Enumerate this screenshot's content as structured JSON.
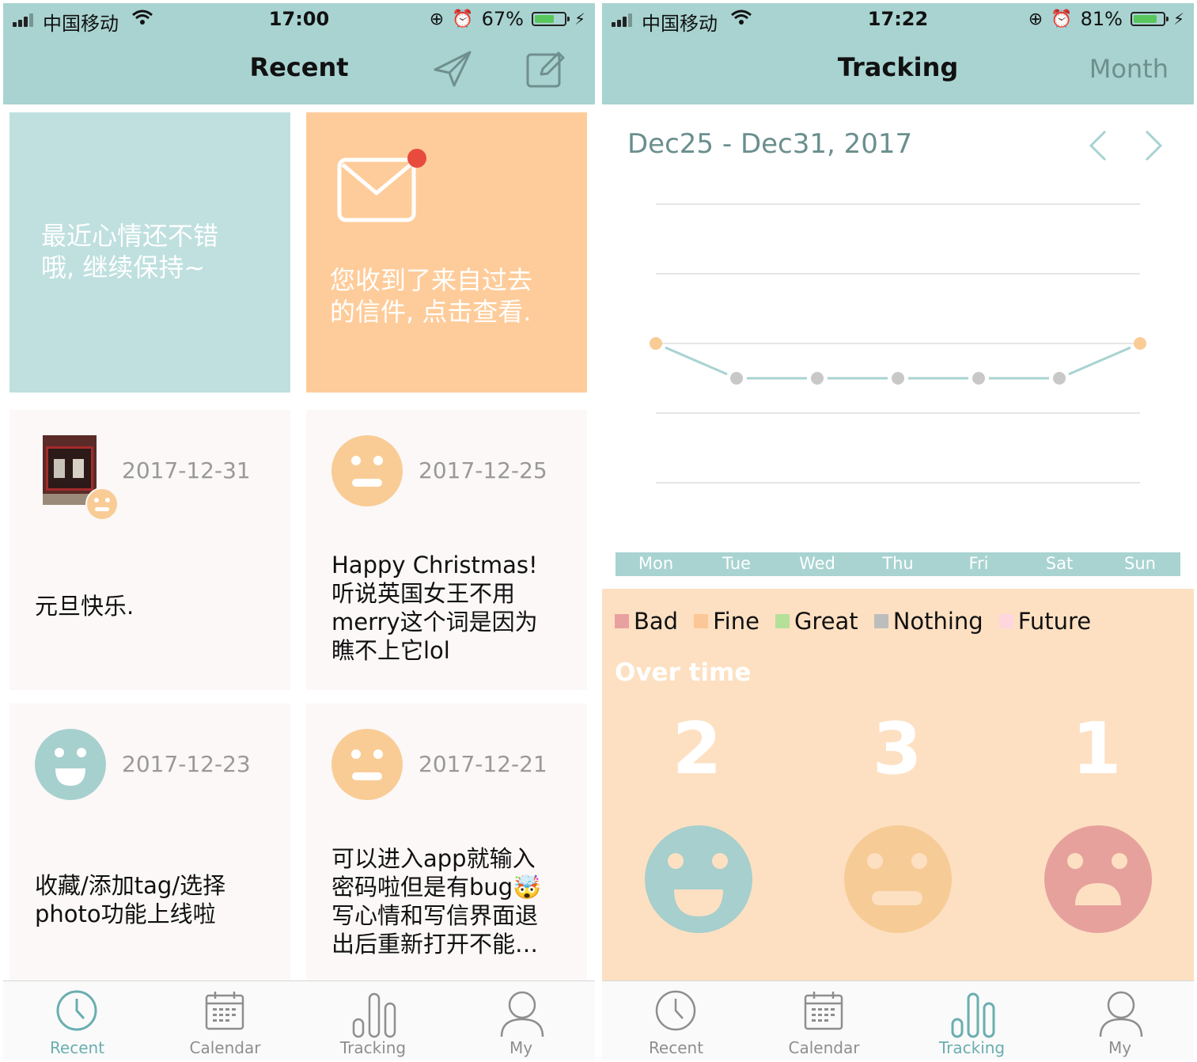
{
  "left": {
    "status": {
      "carrier": "中国移动",
      "time": "17:00",
      "battery": "67%",
      "battery_level": 0.67
    },
    "nav": {
      "title": "Recent",
      "send_icon": "paper-plane-icon",
      "compose_icon": "compose-icon"
    },
    "promo_mood": {
      "text_line1": "最近心情还不错",
      "text_line2": "哦, 继续保持~"
    },
    "promo_letter": {
      "text_line1": "您收到了来自过去",
      "text_line2": "的信件, 点击查看.",
      "icon": "envelope-icon",
      "badge_color": "#e84b3c"
    },
    "cards": [
      {
        "date": "2017-12-31",
        "mood": "fine",
        "has_photo": true,
        "lines": [
          "元旦快乐."
        ]
      },
      {
        "date": "2017-12-25",
        "mood": "fine",
        "lines": [
          "Happy Christmas!",
          "听说英国女王不用",
          "merry这个词是因为",
          "瞧不上它lol"
        ]
      },
      {
        "date": "2017-12-23",
        "mood": "great",
        "lines": [
          "收藏/添加tag/选择",
          "photo功能上线啦"
        ]
      },
      {
        "date": "2017-12-21",
        "mood": "fine",
        "lines": [
          "可以进入app就输入",
          "密码啦但是有bug🤯",
          "写心情和写信界面退",
          "出后重新打开不能…"
        ]
      }
    ]
  },
  "right": {
    "status": {
      "carrier": "中国移动",
      "time": "17:22",
      "battery": "81%",
      "battery_level": 0.81
    },
    "nav": {
      "title": "Tracking",
      "right_label": "Month"
    },
    "range_label": "Dec25 - Dec31, 2017",
    "chart_data": {
      "type": "line",
      "categories": [
        "Mon",
        "Tue",
        "Wed",
        "Thu",
        "Fri",
        "Sat",
        "Sun"
      ],
      "series": [
        {
          "values": [
            2,
            1.5,
            1.5,
            1.5,
            1.5,
            1.5,
            2
          ],
          "point_moods": [
            "fine",
            "nothing",
            "nothing",
            "nothing",
            "nothing",
            "nothing",
            "fine"
          ]
        }
      ],
      "ylim": [
        0,
        4
      ],
      "grid": true
    },
    "legend": [
      {
        "label": "Bad",
        "color": "#e9a0a0"
      },
      {
        "label": "Fine",
        "color": "#fcc796"
      },
      {
        "label": "Great",
        "color": "#b5e09a"
      },
      {
        "label": "Nothing",
        "color": "#bdbdbd"
      },
      {
        "label": "Future",
        "color": "#fdd6de"
      }
    ],
    "overtime_title": "Over time",
    "overtime": [
      {
        "count": "2",
        "mood": "great"
      },
      {
        "count": "3",
        "mood": "fine"
      },
      {
        "count": "1",
        "mood": "bad"
      }
    ]
  },
  "tabs": [
    "Recent",
    "Calendar",
    "Tracking",
    "My"
  ],
  "tab_icons": [
    "clock-icon",
    "calendar-icon",
    "bar-chart-icon",
    "user-icon"
  ],
  "colors": {
    "teal": "#a8d3d1",
    "orange": "#fecc9a",
    "accent": "#6aaeb0",
    "fine": "#f9cc96",
    "great": "#a6d0ce",
    "bad": "#e69e9c",
    "nothing": "#c8c8c8"
  }
}
